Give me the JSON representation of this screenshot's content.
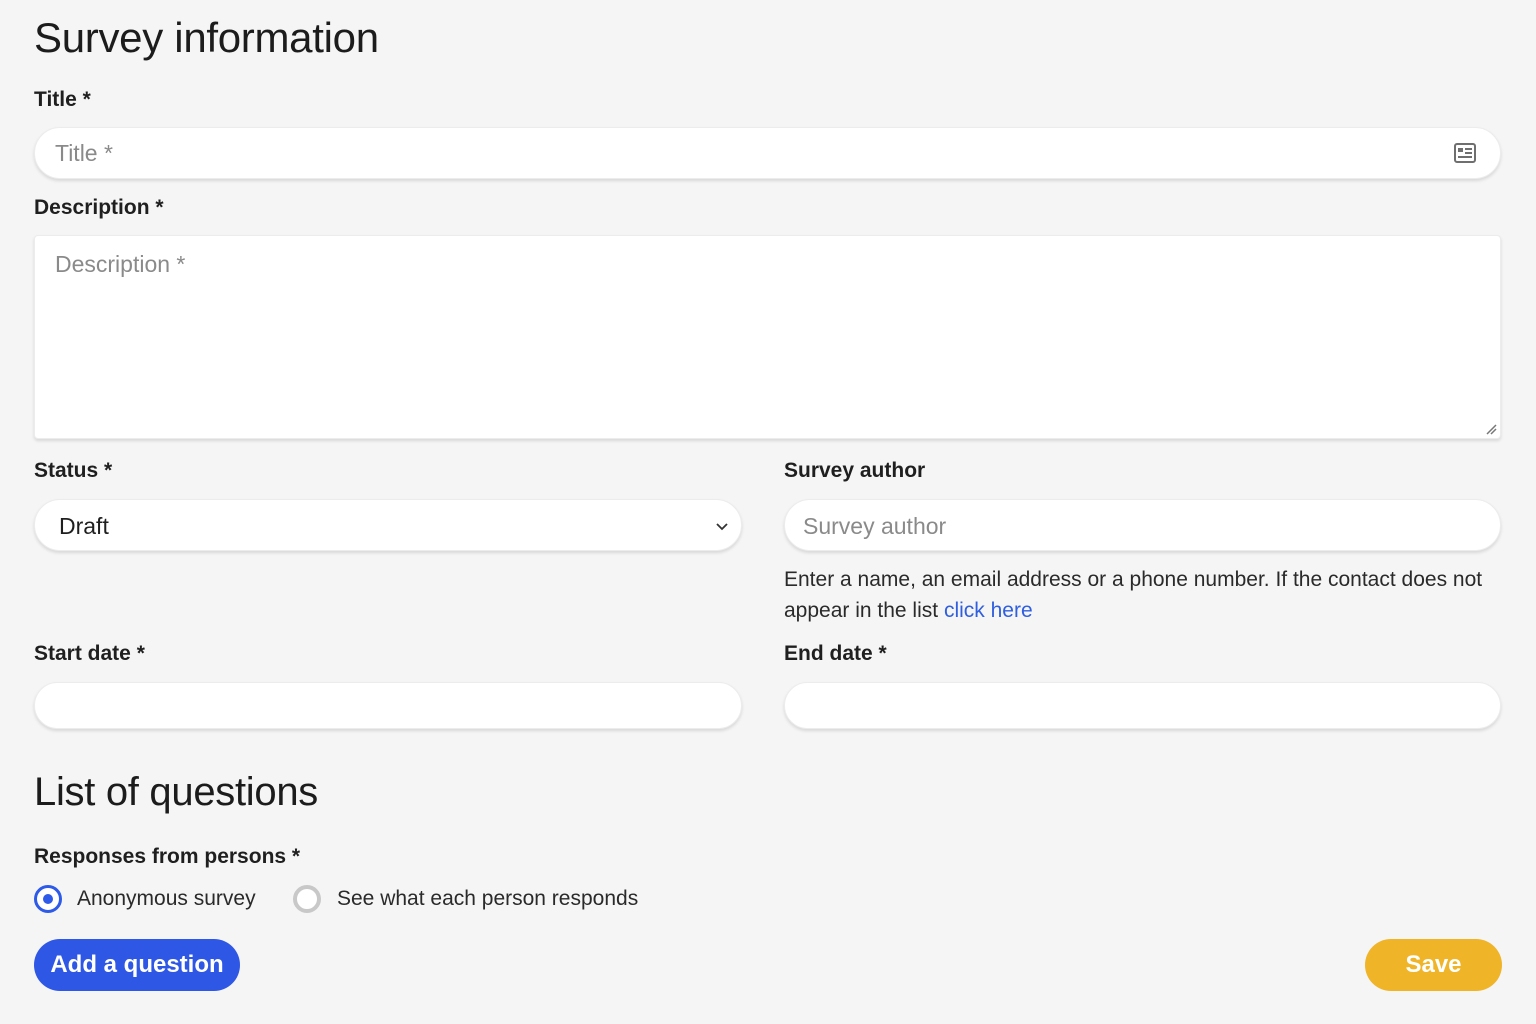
{
  "survey_info": {
    "heading": "Survey information",
    "title_label": "Title *",
    "title_placeholder": "Title *",
    "title_icon": "contact-card-icon",
    "description_label": "Description *",
    "description_placeholder": "Description *",
    "status_label": "Status *",
    "status_value": "Draft",
    "author_label": "Survey author",
    "author_placeholder": "Survey author",
    "author_helper_text": "Enter a name, an email address or a phone number. If the contact does not appear in the list",
    "author_helper_link": "click here",
    "start_date_label": "Start date *",
    "start_date_value": "",
    "end_date_label": "End date *",
    "end_date_value": ""
  },
  "questions": {
    "heading": "List of questions",
    "responses_label": "Responses from persons *",
    "options": [
      {
        "label": "Anonymous survey",
        "selected": true
      },
      {
        "label": "See what each person responds",
        "selected": false
      }
    ],
    "add_button": "Add a question"
  },
  "actions": {
    "save_button": "Save"
  },
  "colors": {
    "primary": "#2e57e6",
    "save": "#f0b429",
    "link": "#2f5fe0"
  }
}
